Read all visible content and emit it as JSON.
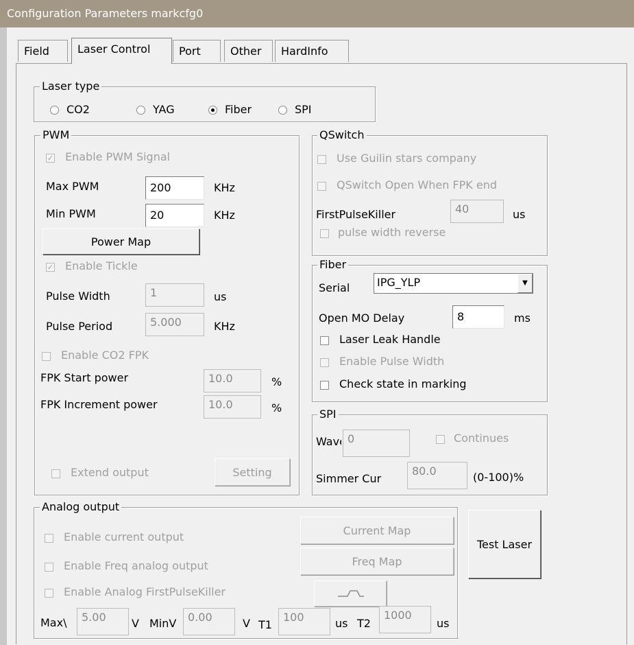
{
  "window": {
    "title": "Configuration Parameters markcfg0"
  },
  "tabs": [
    {
      "label": "Field",
      "active": false
    },
    {
      "label": "Laser Control",
      "active": true
    },
    {
      "label": "Port",
      "active": false
    },
    {
      "label": "Other",
      "active": false
    },
    {
      "label": "HardInfo",
      "active": false
    }
  ],
  "laser_type": {
    "group_label": "Laser type",
    "options": [
      "CO2",
      "YAG",
      "Fiber",
      "SPI"
    ],
    "selected": "Fiber"
  },
  "pwm": {
    "group_label": "PWM",
    "enable_pwm_signal": {
      "label": "Enable PWM Signal",
      "checked": true,
      "enabled": false
    },
    "max_pwm": {
      "label": "Max PWM",
      "value": "200",
      "unit": "KHz"
    },
    "min_pwm": {
      "label": "Min PWM",
      "value": "20",
      "unit": "KHz"
    },
    "power_map_button": "Power Map",
    "enable_tickle": {
      "label": "Enable Tickle",
      "checked": true,
      "enabled": false
    },
    "pulse_width": {
      "label": "Pulse Width",
      "value": "1",
      "unit": "us"
    },
    "pulse_period": {
      "label": "Pulse Period",
      "value": "5.000",
      "unit": "KHz"
    },
    "enable_co2_fpk": {
      "label": "Enable CO2 FPK",
      "checked": false,
      "enabled": false
    },
    "fpk_start_power": {
      "label": "FPK Start power",
      "value": "10.0",
      "unit": "%"
    },
    "fpk_increment_power": {
      "label": "FPK Increment power",
      "value": "10.0",
      "unit": "%"
    },
    "extend_output": {
      "label": "Extend output",
      "checked": false,
      "enabled": false
    },
    "setting_button": "Setting"
  },
  "qswitch": {
    "group_label": "QSwitch",
    "use_guilin": {
      "label": "Use Guilin stars company",
      "checked": false,
      "enabled": false
    },
    "open_when_fpk_end": {
      "label": "QSwitch Open When FPK end",
      "checked": false,
      "enabled": false
    },
    "first_pulse_killer": {
      "label": "FirstPulseKiller",
      "value": "40",
      "unit": "us"
    },
    "pulse_width_reverse": {
      "label": "pulse width reverse",
      "checked": false,
      "enabled": false
    }
  },
  "fiber": {
    "group_label": "Fiber",
    "serial": {
      "label": "Serial",
      "selected": "IPG_YLP"
    },
    "open_mo_delay": {
      "label": "Open MO Delay",
      "value": "8",
      "unit": "ms"
    },
    "laser_leak_handle": {
      "label": "Laser Leak Handle",
      "checked": false,
      "enabled": true
    },
    "enable_pulse_width": {
      "label": "Enable Pulse Width",
      "checked": false,
      "enabled": false
    },
    "check_state": {
      "label": "Check state in marking",
      "checked": false,
      "enabled": true
    }
  },
  "spi": {
    "group_label": "SPI",
    "wave": {
      "label": "Wave",
      "value": "0"
    },
    "continues": {
      "label": "Continues",
      "checked": false,
      "enabled": false
    },
    "simmer_cur": {
      "label": "Simmer Cur",
      "value": "80.0",
      "unit": "(0-100)%"
    }
  },
  "analog_output": {
    "group_label": "Analog output",
    "enable_current_output": {
      "label": "Enable current output",
      "checked": false,
      "enabled": false
    },
    "enable_freq_analog_output": {
      "label": "Enable Freq analog output",
      "checked": false,
      "enabled": false
    },
    "enable_analog_fpk": {
      "label": "Enable Analog FirstPulseKiller",
      "checked": false,
      "enabled": false
    },
    "current_map_button": "Current Map",
    "freq_map_button": "Freq Map",
    "maxv": {
      "label": "Max\\",
      "value": "5.00",
      "unit": "V"
    },
    "minv": {
      "label": "MinV",
      "value": "0.00",
      "unit": "V"
    },
    "t1": {
      "label": "T1",
      "value": "100",
      "unit": "us"
    },
    "t2": {
      "label": "T2",
      "value": "1000",
      "unit": "us"
    }
  },
  "test_laser_button": "Test Laser",
  "colors": {
    "titlebar": "#a39786",
    "window_bg": "#f0f0f0",
    "disabled_text": "#a0a0a0"
  }
}
